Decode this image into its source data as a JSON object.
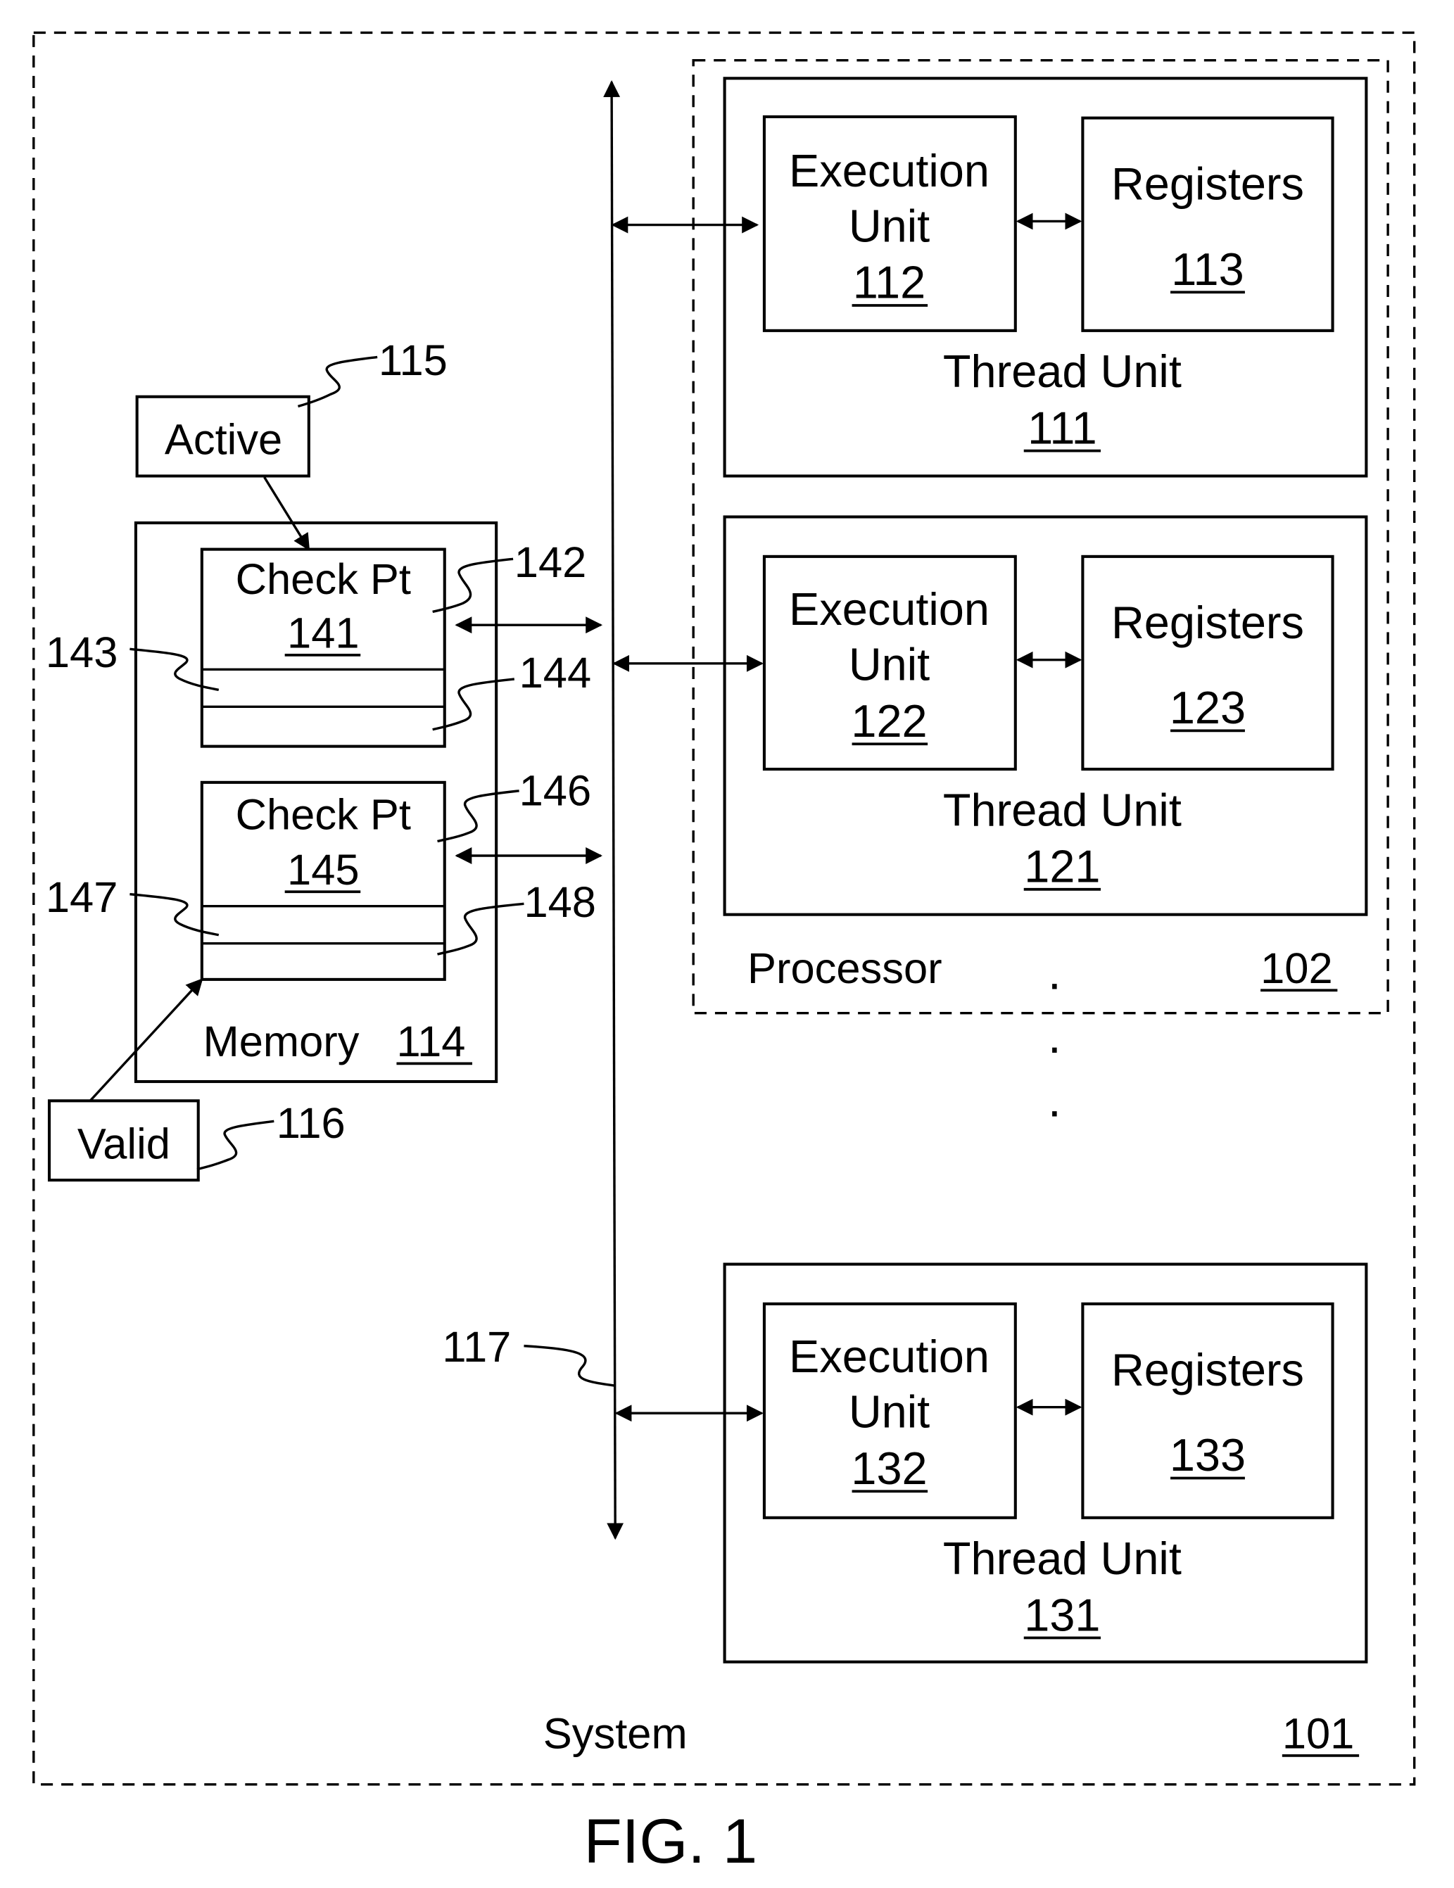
{
  "system": {
    "label": "System",
    "ref": "101"
  },
  "processor": {
    "label": "Processor",
    "ref": "102"
  },
  "thread_units": [
    {
      "label": "Thread Unit",
      "ref": "111",
      "exec_line1": "Execution",
      "exec_line2": "Unit",
      "exec_ref": "112",
      "reg_label": "Registers",
      "reg_ref": "113"
    },
    {
      "label": "Thread Unit",
      "ref": "121",
      "exec_line1": "Execution",
      "exec_line2": "Unit",
      "exec_ref": "122",
      "reg_label": "Registers",
      "reg_ref": "123"
    },
    {
      "label": "Thread Unit",
      "ref": "131",
      "exec_line1": "Execution",
      "exec_line2": "Unit",
      "exec_ref": "132",
      "reg_label": "Registers",
      "reg_ref": "133"
    }
  ],
  "memory": {
    "label": "Memory",
    "ref": "114"
  },
  "checkpoints": [
    {
      "label": "Check Pt",
      "ref": "141",
      "callout_top": "142",
      "callout_left": "143",
      "callout_bottom": "144"
    },
    {
      "label": "Check Pt",
      "ref": "145",
      "callout_top": "146",
      "callout_left": "147",
      "callout_bottom": "148"
    }
  ],
  "active": {
    "label": "Active",
    "ref": "115"
  },
  "valid": {
    "label": "Valid",
    "ref": "116"
  },
  "bus": {
    "ref": "117"
  },
  "ellipsis": ".",
  "figure_caption": "FIG. 1"
}
